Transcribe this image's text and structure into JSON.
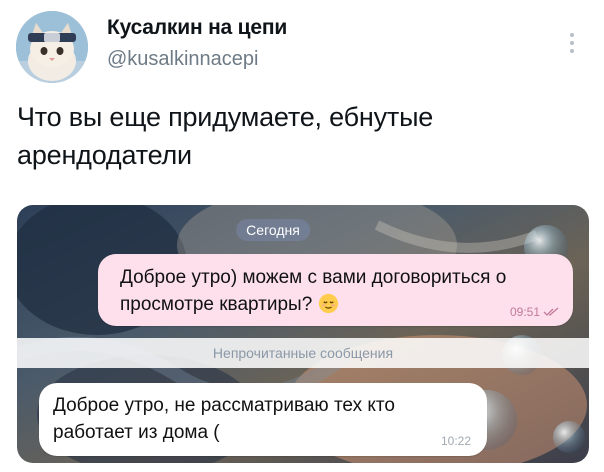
{
  "author": {
    "name": "Кусалкин на цепи",
    "handle": "@kusalkinnacepi"
  },
  "tweet": {
    "text": "Что вы еще придумаете, ебнутые арендодатели"
  },
  "chat": {
    "date_label": "Сегодня",
    "outgoing": {
      "text": "Доброе утро) можем с вами договориться о просмотре квартиры?",
      "time": "09:51",
      "emoji": "relieved-face"
    },
    "unread_label": "Непрочитанные сообщения",
    "incoming": {
      "text": "Доброе утро, не рассматриваю тех кто работает из дома (",
      "time": "10:22"
    }
  },
  "icons": {
    "more": "more-vertical-icon",
    "read_receipt": "double-check-icon",
    "avatar": "cat-avatar"
  },
  "colors": {
    "outgoing_bubble": "#fde0ec",
    "incoming_bubble": "#ffffff",
    "handle": "#6e7b86"
  }
}
